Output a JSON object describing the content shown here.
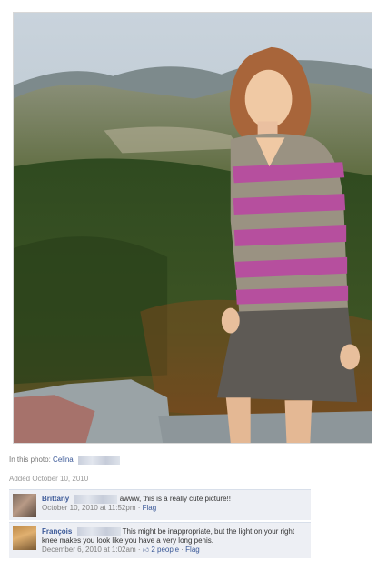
{
  "photo": {
    "alt": ""
  },
  "tag_line": {
    "prefix": "In this photo:",
    "name": "Celina"
  },
  "added": "Added October 10, 2010",
  "comments": [
    {
      "author": "Brittany",
      "text": "awww, this is a really cute picture!!",
      "timestamp": "October 10, 2010 at 11:52pm",
      "separator": "·",
      "flag": "Flag"
    },
    {
      "author": "François",
      "text": "This might be inappropriate, but the light on your right knee makes you look like you have a very long penis.",
      "timestamp": "December 6, 2010 at 1:02am",
      "separator": "·",
      "likes": "2 people",
      "flag": "Flag"
    }
  ],
  "colors": {
    "link": "#3b5998",
    "comment_bg": "#edeff4"
  },
  "icons": {
    "like": "thumbs-up-icon"
  }
}
